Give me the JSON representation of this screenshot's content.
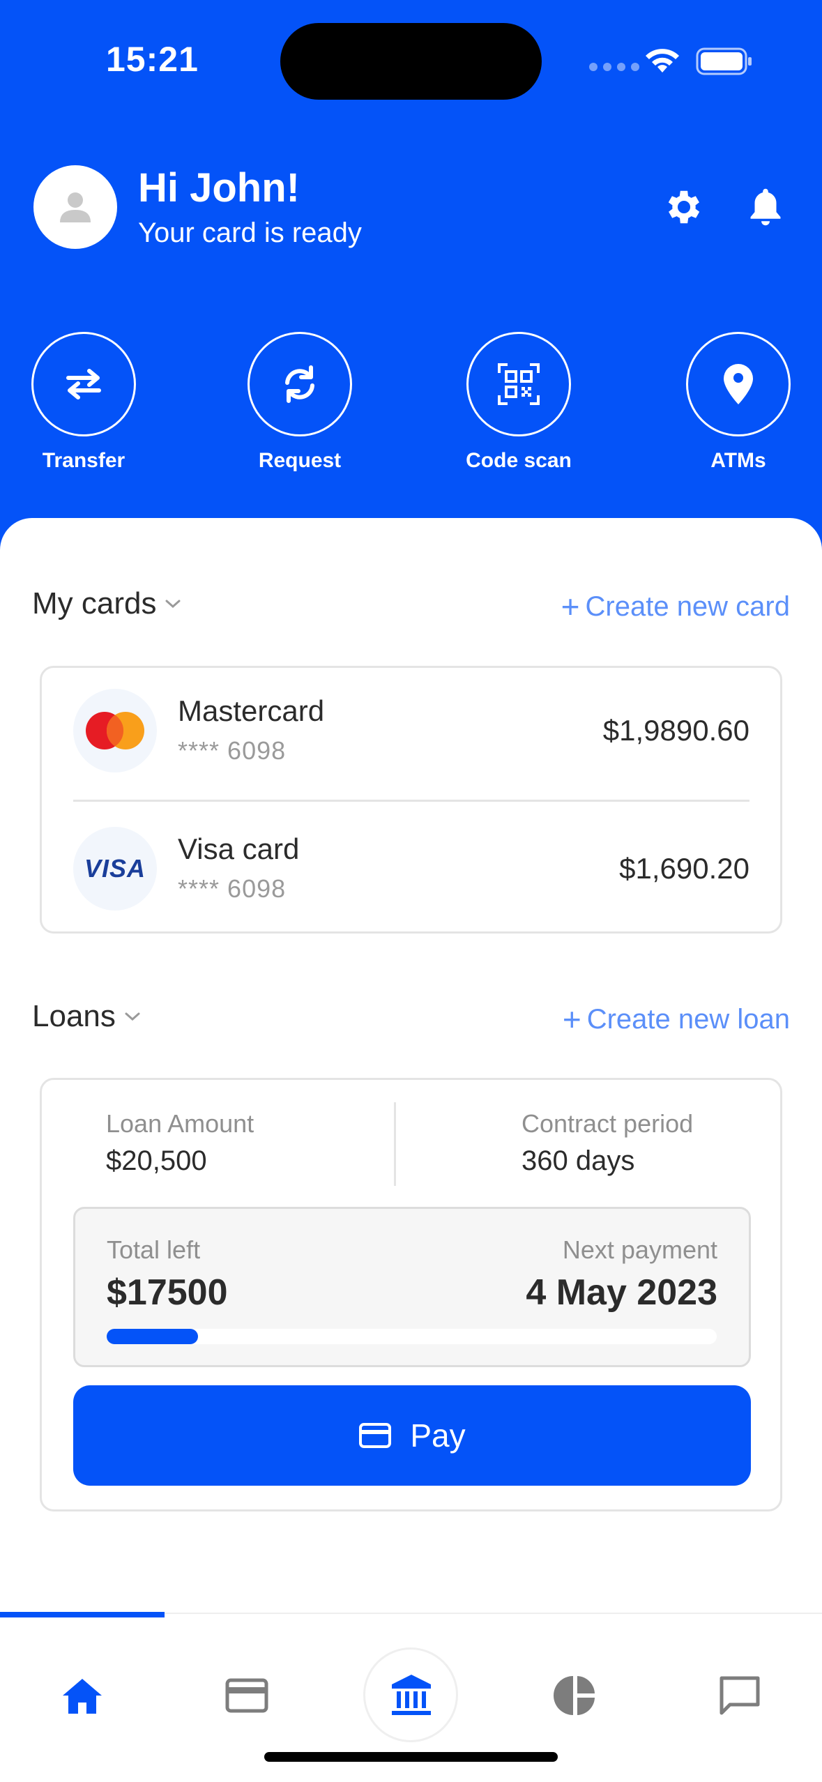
{
  "status_bar": {
    "time": "15:21"
  },
  "header": {
    "greeting": "Hi John!",
    "subtitle": "Your card is ready",
    "avatar_icon": "user-icon",
    "settings_icon": "gear-icon",
    "notifications_icon": "bell-icon"
  },
  "quick_actions": [
    {
      "label": "Transfer",
      "icon": "transfer-arrows-icon"
    },
    {
      "label": "Request",
      "icon": "refresh-icon"
    },
    {
      "label": "Code scan",
      "icon": "qr-code-icon"
    },
    {
      "label": "ATMs",
      "icon": "location-pin-icon"
    }
  ],
  "cards_section": {
    "title": "My cards",
    "create_label": "Create new card",
    "cards": [
      {
        "name": "Mastercard",
        "number": "**** 6098",
        "amount": "$1,9890.60",
        "logo": "mastercard"
      },
      {
        "name": "Visa card",
        "number": "**** 6098",
        "amount": "$1,690.20",
        "logo": "VISA"
      }
    ]
  },
  "loans_section": {
    "title": "Loans",
    "create_label": "Create new loan",
    "loan_amount_label": "Loan Amount",
    "loan_amount_value": "$20,500",
    "contract_label": "Contract period",
    "contract_value": "360 days",
    "total_left_label": "Total left",
    "total_left_value": "$17500",
    "next_payment_label": "Next payment",
    "next_payment_value": "4 May 2023",
    "progress_fraction": 0.15,
    "pay_label": "Pay"
  },
  "bottom_nav": [
    {
      "name": "home",
      "icon": "home-icon",
      "active": true
    },
    {
      "name": "cards",
      "icon": "card-icon",
      "active": false
    },
    {
      "name": "bank",
      "icon": "bank-icon",
      "active": false
    },
    {
      "name": "analytics",
      "icon": "pie-chart-icon",
      "active": false
    },
    {
      "name": "messages",
      "icon": "chat-icon",
      "active": false
    }
  ],
  "colors": {
    "primary": "#0453f8",
    "link": "#5b8ff9",
    "text": "#2b2b2b",
    "muted": "#9a9a9a"
  }
}
